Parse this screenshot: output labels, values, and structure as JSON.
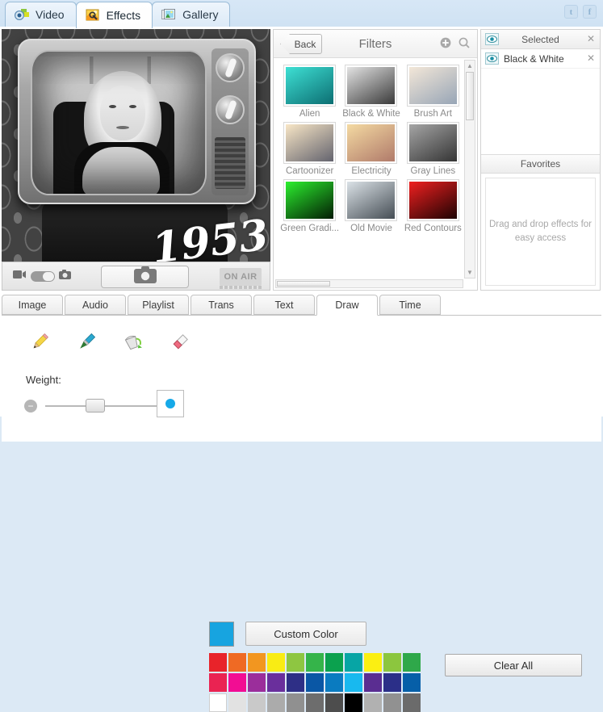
{
  "app": {
    "top_tabs": [
      {
        "label": "Video",
        "icon": "video-camera-icon",
        "active": false
      },
      {
        "label": "Effects",
        "icon": "magic-wand-icon",
        "active": true
      },
      {
        "label": "Gallery",
        "icon": "gallery-icon",
        "active": false
      }
    ],
    "social": [
      {
        "label": "t",
        "name": "twitter-icon"
      },
      {
        "label": "f",
        "name": "facebook-icon"
      }
    ]
  },
  "preview": {
    "drawn_text": "1953",
    "on_air_label": "ON AIR",
    "capture_icon": "camera-icon",
    "video_icon": "video-camera-icon",
    "photo_icon": "camera-icon",
    "mode_toggle": "video-photo-toggle"
  },
  "filters": {
    "back_label": "Back",
    "title": "Filters",
    "add_icon": "plus-circle-icon",
    "search_icon": "search-icon",
    "items": [
      {
        "label": "Alien",
        "color_a": "#2fd2c8",
        "color_b": "#0c6e72"
      },
      {
        "label": "Black & White",
        "color_a": "#d8d8d8",
        "color_b": "#3a3a3a"
      },
      {
        "label": "Brush Art",
        "color_a": "#efe3d6",
        "color_b": "#9aa6b4"
      },
      {
        "label": "Cartoonizer",
        "color_a": "#f6e2c3",
        "color_b": "#6f6f7a"
      },
      {
        "label": "Electricity",
        "color_a": "#f1d7a0",
        "color_b": "#b07a6a"
      },
      {
        "label": "Gray Lines",
        "color_a": "#9a9a9a",
        "color_b": "#3d3d3d"
      },
      {
        "label": "Green Gradi...",
        "color_a": "#27e02a",
        "color_b": "#031c04"
      },
      {
        "label": "Old Movie",
        "color_a": "#d6dde2",
        "color_b": "#4a5258"
      },
      {
        "label": "Red Contours",
        "color_a": "#e01b1b",
        "color_b": "#200404"
      }
    ]
  },
  "sidebar": {
    "selected_header": "Selected",
    "selected_items": [
      {
        "label": "Black & White"
      }
    ],
    "favorites_header": "Favorites",
    "favorites_placeholder": "Drag and drop effects for easy access",
    "eye_icon": "eye-icon",
    "close_icon": "close-icon"
  },
  "bottom_tabs": [
    {
      "label": "Image",
      "active": false
    },
    {
      "label": "Audio",
      "active": false
    },
    {
      "label": "Playlist",
      "active": false
    },
    {
      "label": "Trans",
      "active": false
    },
    {
      "label": "Text",
      "active": false
    },
    {
      "label": "Draw",
      "active": true
    },
    {
      "label": "Time",
      "active": false
    }
  ],
  "draw": {
    "tools": [
      {
        "name": "pencil-tool-icon",
        "label": "Pencil"
      },
      {
        "name": "brush-tool-icon",
        "label": "Brush"
      },
      {
        "name": "paint-bucket-tool-icon",
        "label": "Paint Bucket"
      },
      {
        "name": "eraser-tool-icon",
        "label": "Eraser"
      }
    ],
    "weight_label": "Weight:",
    "weight_decrease": "−",
    "weight_increase": "+",
    "weight_value": 36,
    "brush_preview_color": "#16a9e8",
    "brush_preview_size": 12,
    "current_color": "#17a4e0",
    "custom_color_label": "Custom Color",
    "clear_all_label": "Clear All",
    "palette": [
      [
        "#e8232a",
        "#ea2352",
        "#ffffff"
      ],
      [
        "#ef6a24",
        "#f20d93",
        "#e2e2e2"
      ],
      [
        "#f29620",
        "#9b2e9b",
        "#c9c9c9"
      ],
      [
        "#f9ec14",
        "#6a2f9c",
        "#ababab"
      ],
      [
        "#8ec641",
        "#2e2f86",
        "#909090"
      ],
      [
        "#35b44a",
        "#0a57a5",
        "#6d6d6d"
      ],
      [
        "#0ba14e",
        "#0a7bc0",
        "#4d4d4d"
      ],
      [
        "#07a5a5",
        "#18b9ef",
        "#000000"
      ],
      [
        "#fbef12",
        "#5a2d91",
        "#b1b1b1"
      ],
      [
        "#8cc63e",
        "#2b2f88",
        "#919191"
      ],
      [
        "#2fa84a",
        "#065fa8",
        "#6b6b6b"
      ]
    ]
  }
}
